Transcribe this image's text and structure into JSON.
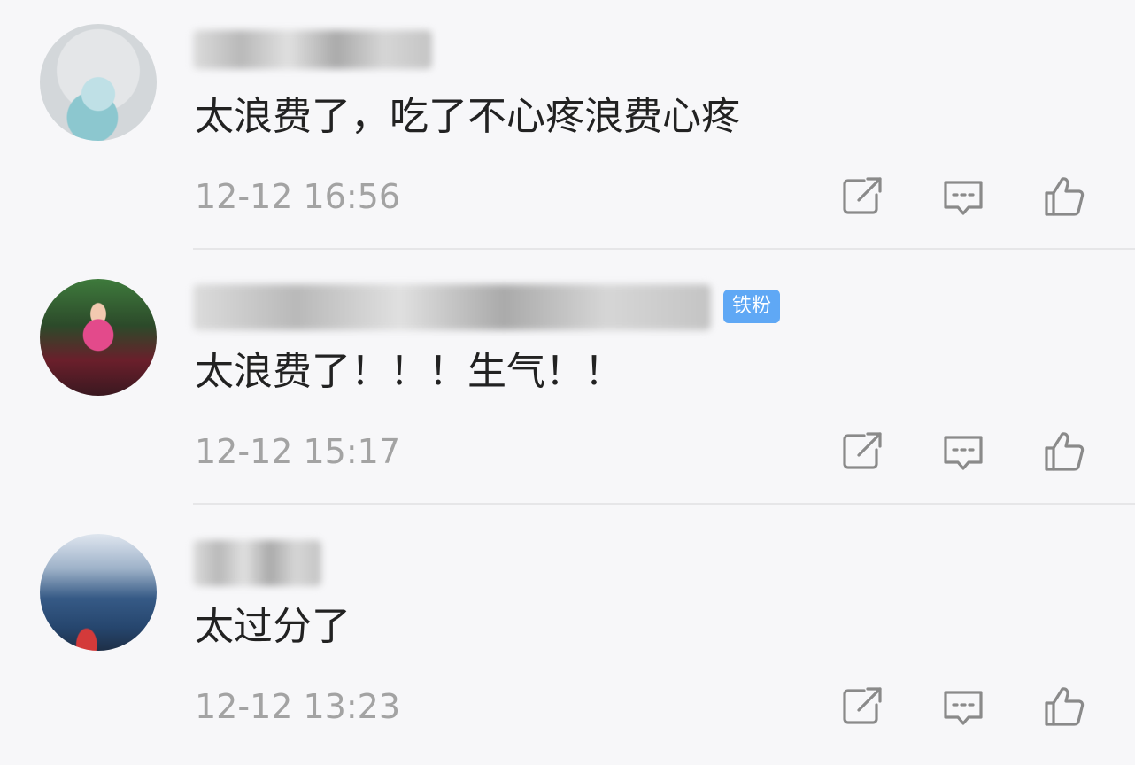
{
  "comments": [
    {
      "username": "",
      "badge": "",
      "text": "太浪费了，吃了不心疼浪费心疼",
      "time": "12-12 16:56"
    },
    {
      "username": "",
      "badge": "铁粉",
      "text": "太浪费了！！！生气！！",
      "time": "12-12 15:17"
    },
    {
      "username": "",
      "badge": "",
      "text": "太过分了",
      "time": "12-12 13:23"
    }
  ],
  "icons": {
    "share": "share-icon",
    "reply": "comment-icon",
    "like": "thumbs-up-icon"
  },
  "colors": {
    "background": "#f7f7f9",
    "text": "#222222",
    "timestamp": "#a3a3a3",
    "badge": "#5fa8f5",
    "icon": "#8a8a8a"
  }
}
